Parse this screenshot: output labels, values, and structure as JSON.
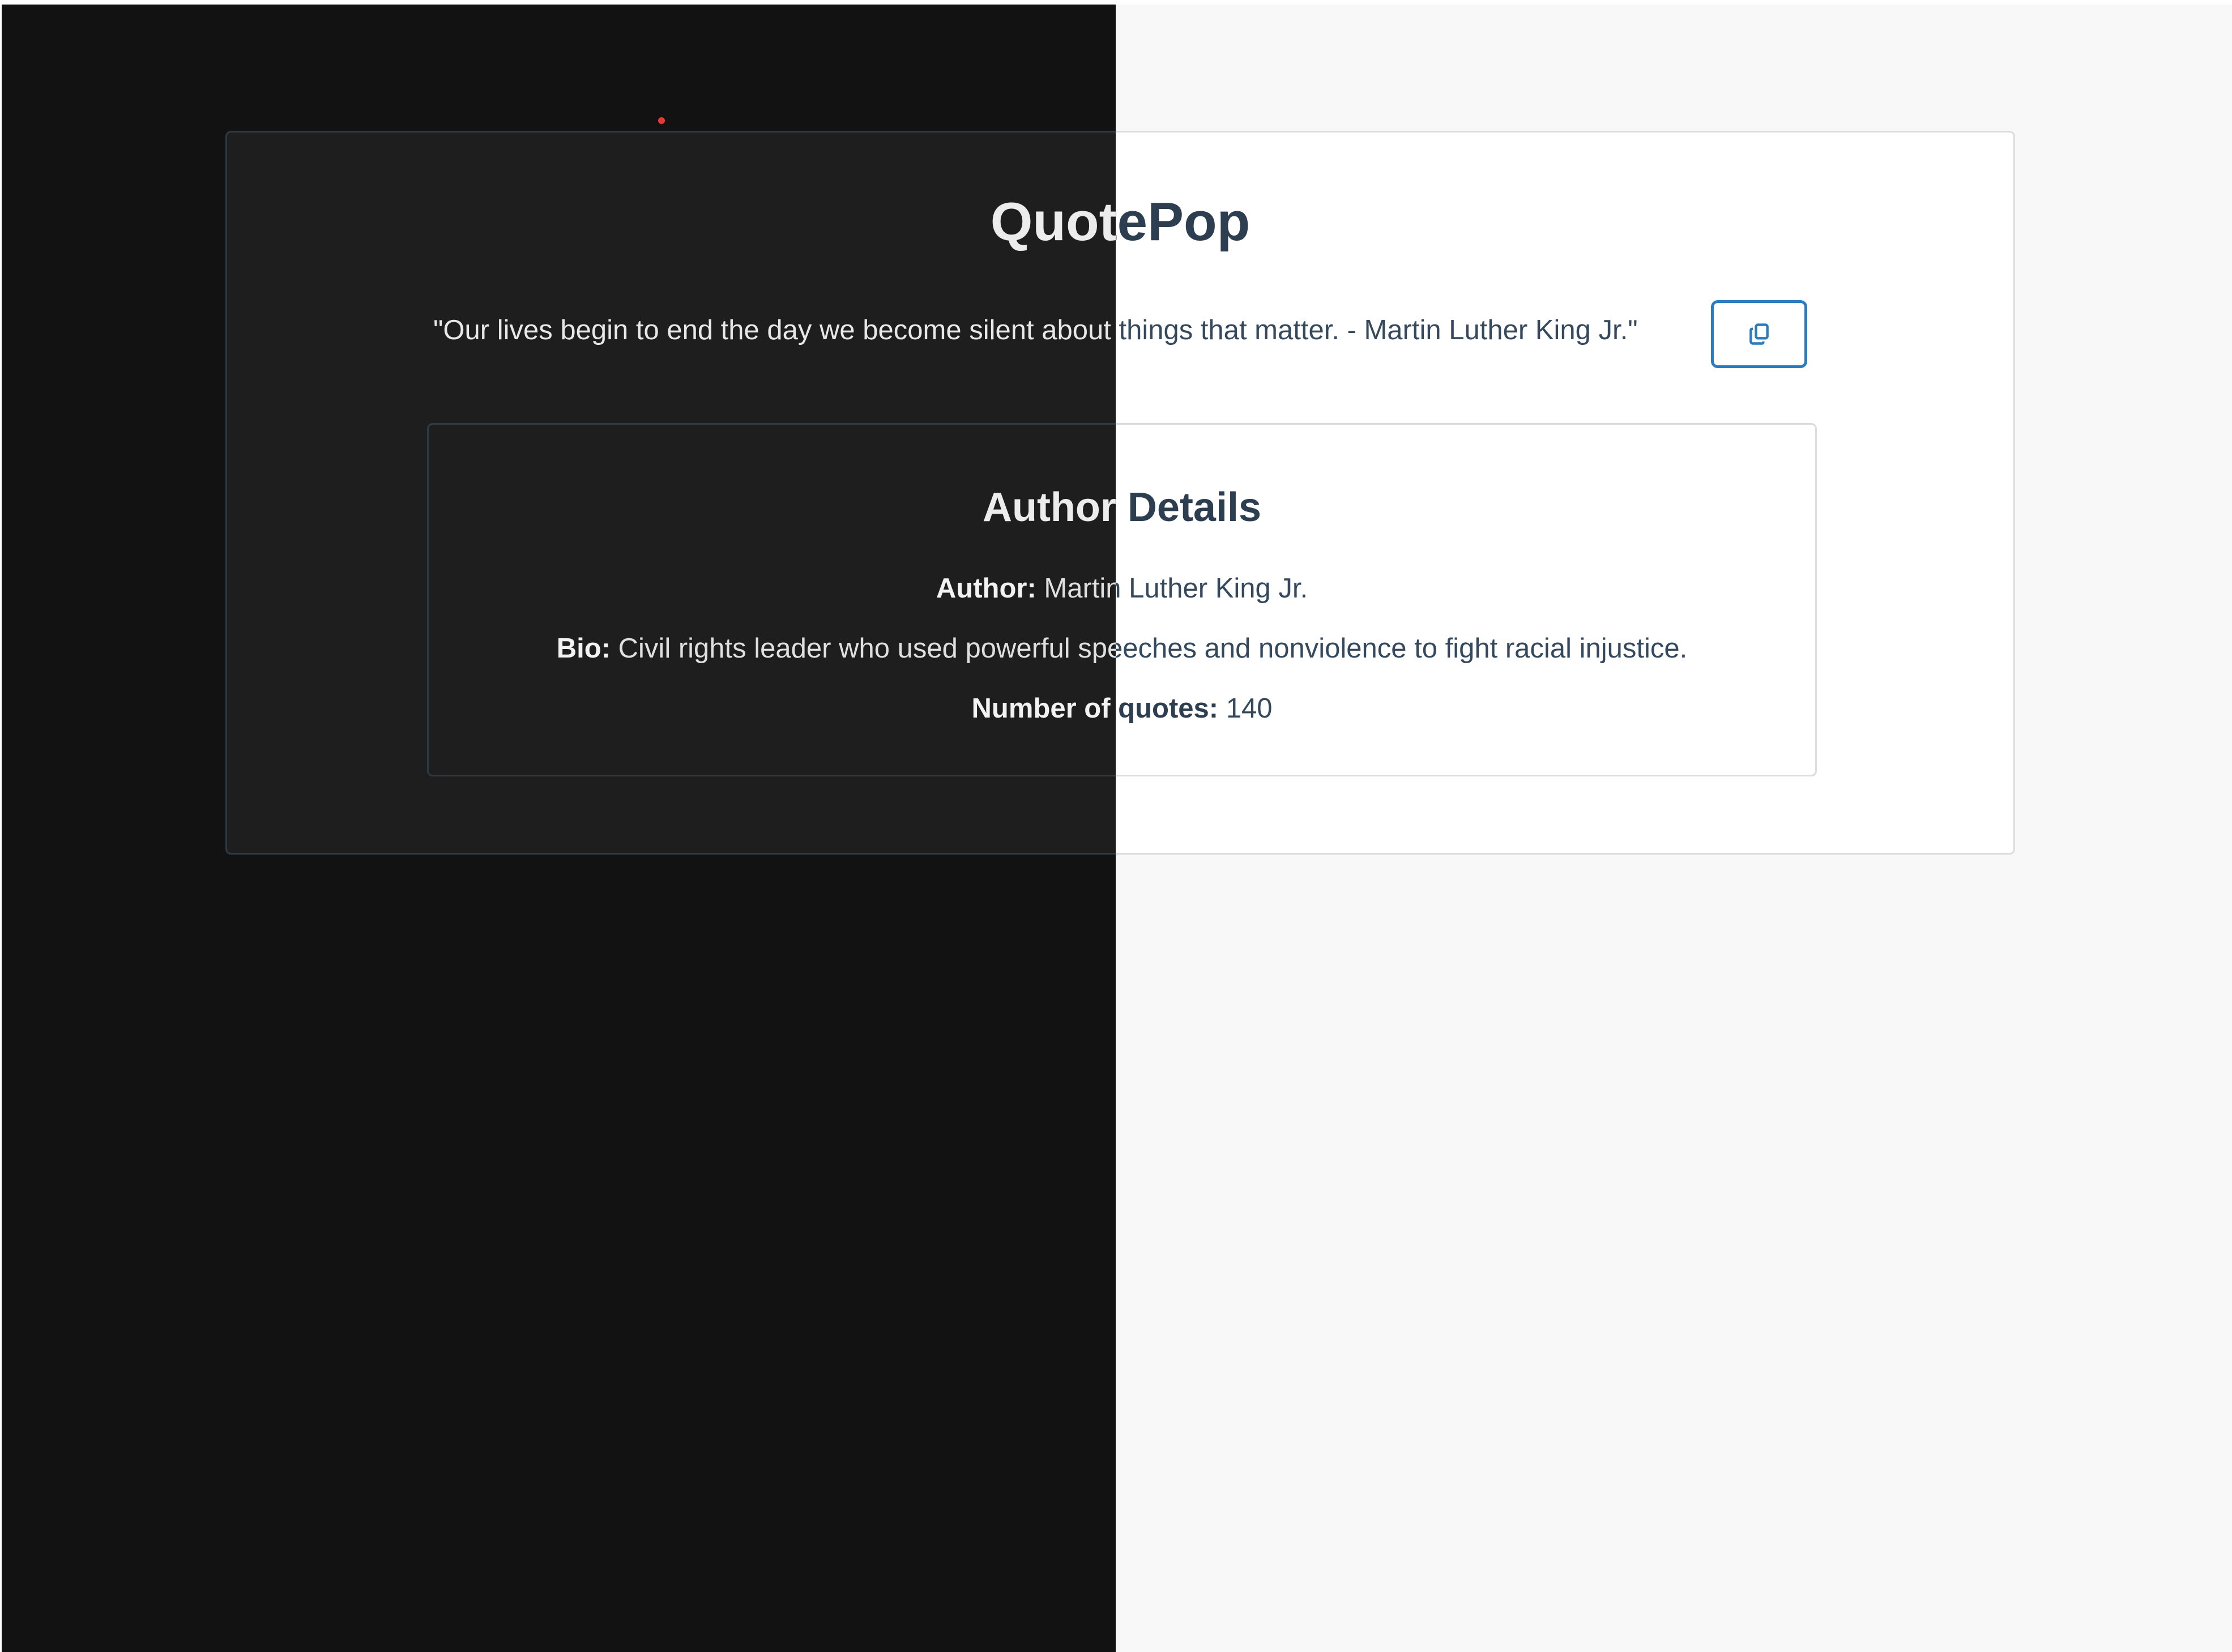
{
  "app": {
    "title": "QuotePop"
  },
  "quote": {
    "text": "\"Our lives begin to end the day we become silent about things that matter. - Martin Luther King Jr.\"",
    "copy_icon": "copy-icon"
  },
  "author_details": {
    "heading": "Author Details",
    "author_label": "Author:",
    "author_value": "Martin Luther King Jr.",
    "bio_label": "Bio:",
    "bio_value": "Civil rights leader who used powerful speeches and nonviolence to fight racial injustice.",
    "count_label": "Number of quotes:",
    "count_value": "140"
  },
  "theme": {
    "accent": "#2a7bbf",
    "light_background": "#f8f8f8",
    "dark_background": "#121212",
    "marker": "#e53935"
  }
}
